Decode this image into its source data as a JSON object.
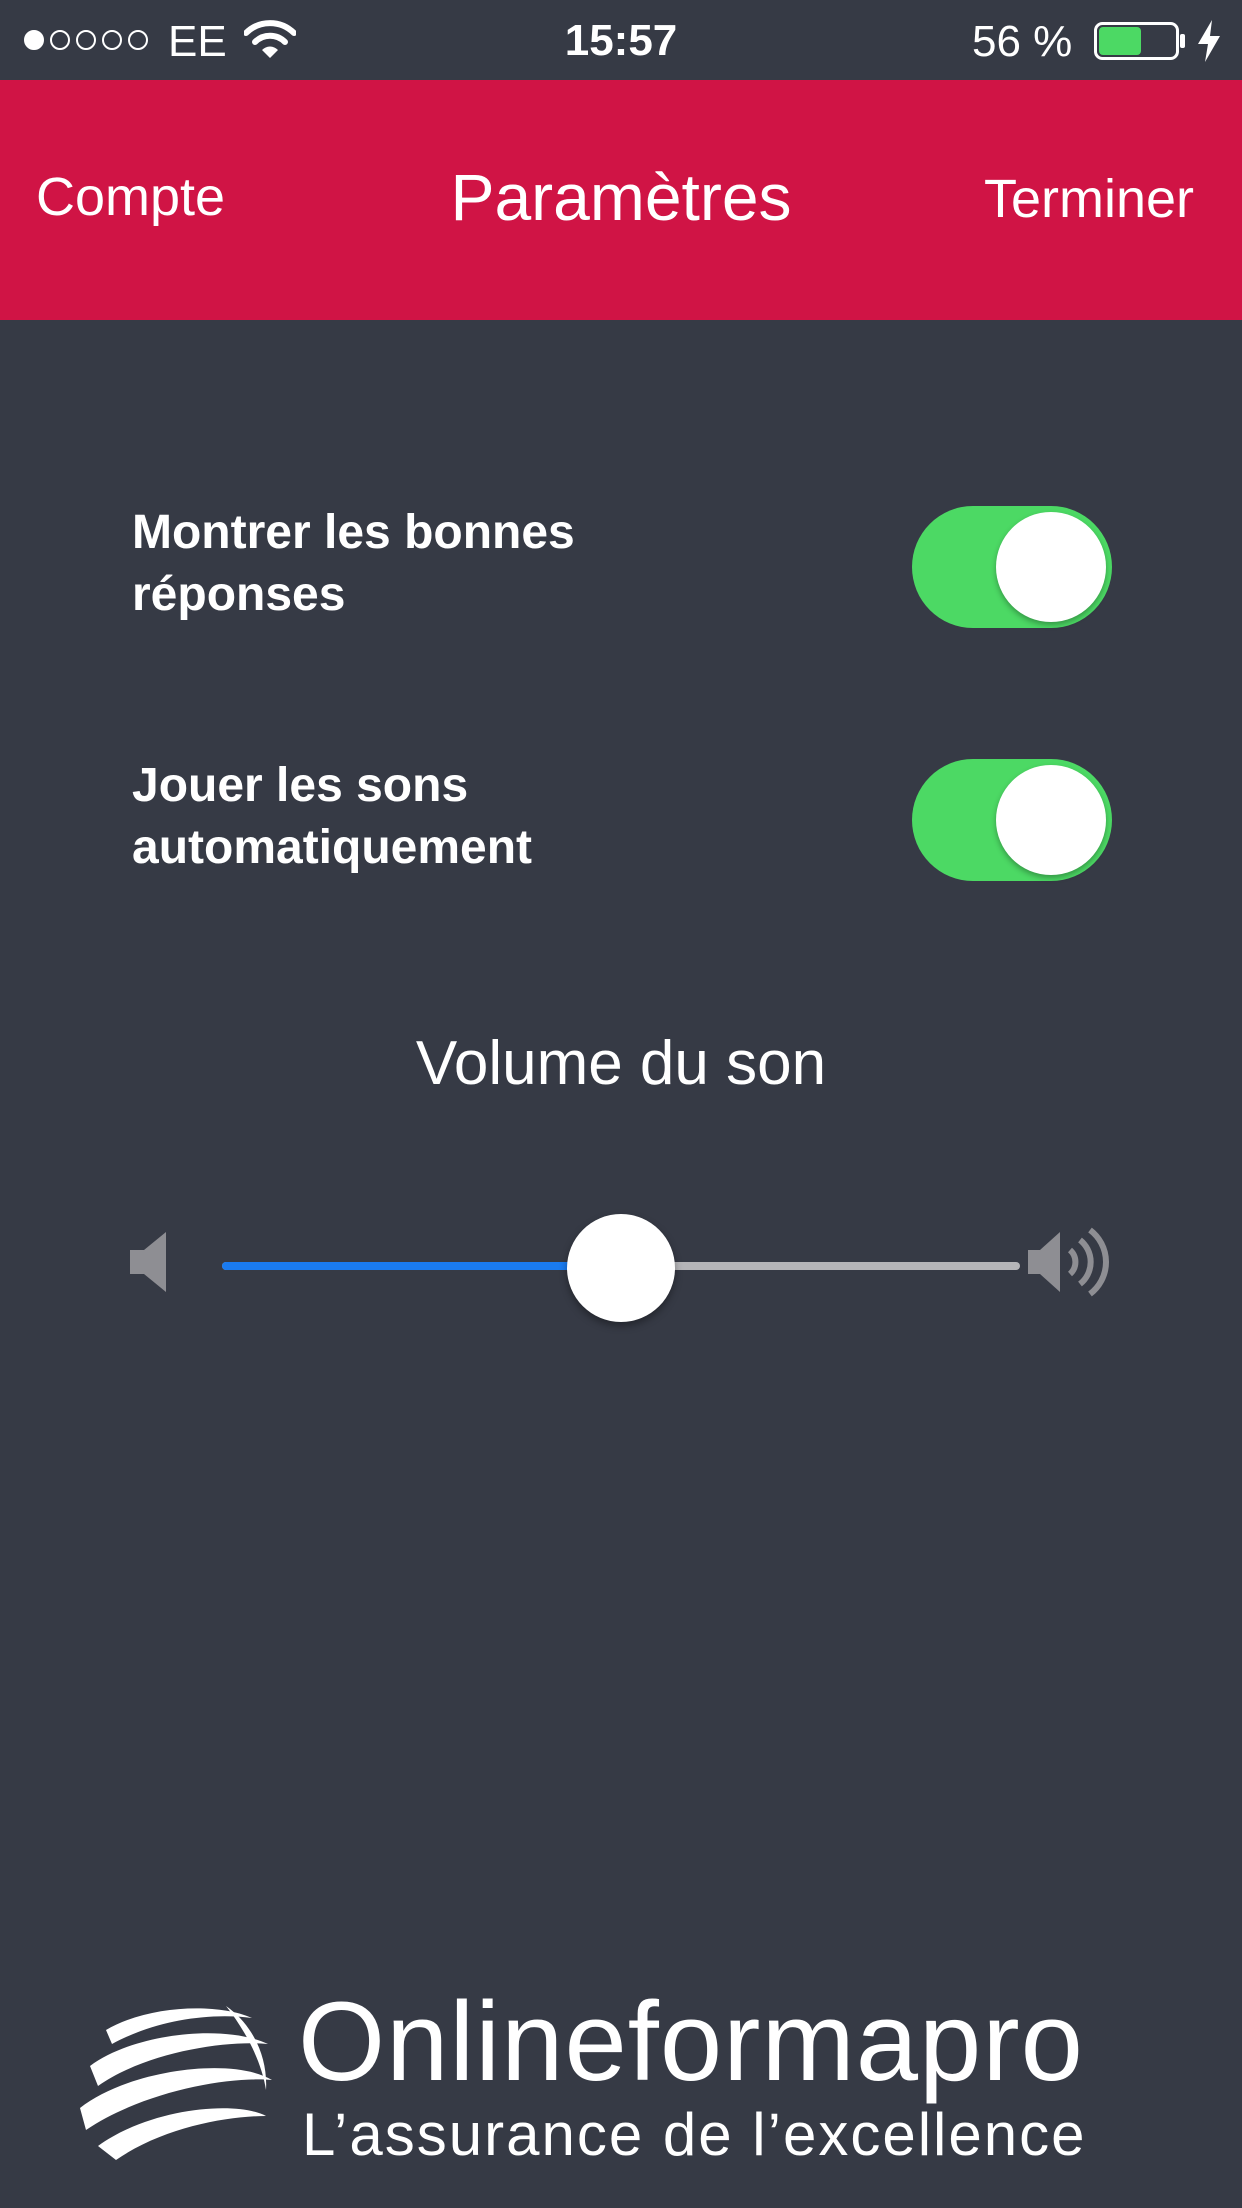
{
  "status_bar": {
    "signal_bars_filled": 1,
    "signal_bars_total": 5,
    "carrier": "EE",
    "time": "15:57",
    "battery_percent_text": "56 %",
    "battery_level": 0.56,
    "battery_color": "#4cd964",
    "charging": true
  },
  "nav": {
    "left_label": "Compte",
    "title": "Paramètres",
    "right_label": "Terminer",
    "background_color": "#d01445"
  },
  "settings": [
    {
      "label_line1": "Montrer les bonnes",
      "label_line2": "réponses",
      "enabled": true
    },
    {
      "label_line1": "Jouer les sons",
      "label_line2": "automatiquement",
      "enabled": true
    }
  ],
  "volume": {
    "title": "Volume du son",
    "level": 0.5,
    "fill_color": "#1a7bf0"
  },
  "brand": {
    "name": "Onlineformapro",
    "tagline": "L’assurance de l’excellence"
  },
  "colors": {
    "background": "#363a45",
    "toggle_on": "#4cd964"
  }
}
